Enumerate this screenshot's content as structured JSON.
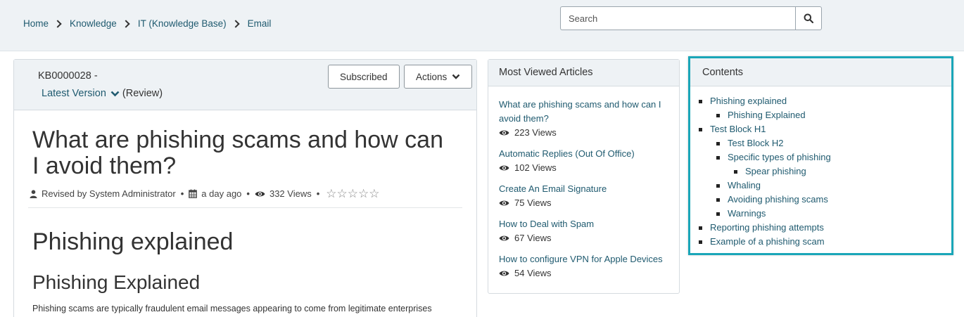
{
  "breadcrumb": [
    "Home",
    "Knowledge",
    "IT (Knowledge Base)",
    "Email"
  ],
  "search": {
    "placeholder": "Search"
  },
  "article": {
    "kb_number": "KB0000028 -",
    "version_label": "Latest Version",
    "version_status": "(Review)",
    "subscribed_label": "Subscribed",
    "actions_label": "Actions",
    "title": "What are phishing scams and how can I avoid them?",
    "meta": {
      "revised_by": "Revised by System Administrator",
      "time_ago": "a day ago",
      "views": "332 Views",
      "rating": 0,
      "max_rating": 5
    },
    "heading1": "Phishing explained",
    "heading2": "Phishing Explained",
    "paragraph": "Phishing scams are typically fraudulent email messages appearing to come from legitimate enterprises"
  },
  "most_viewed": {
    "title": "Most Viewed Articles",
    "items": [
      {
        "title": "What are phishing scams and how can I avoid them?",
        "views": "223 Views"
      },
      {
        "title": "Automatic Replies (Out Of Office)",
        "views": "102 Views"
      },
      {
        "title": "Create An Email Signature",
        "views": "75 Views"
      },
      {
        "title": "How to Deal with Spam",
        "views": "67 Views"
      },
      {
        "title": "How to configure VPN for Apple Devices",
        "views": "54 Views"
      }
    ]
  },
  "contents": {
    "title": "Contents",
    "items": [
      {
        "label": "Phishing explained",
        "level": 1
      },
      {
        "label": "Phishing Explained",
        "level": 2
      },
      {
        "label": "Test Block H1",
        "level": 1
      },
      {
        "label": "Test Block H2",
        "level": 2
      },
      {
        "label": "Specific types of phishing",
        "level": 2
      },
      {
        "label": "Spear phishing",
        "level": 3
      },
      {
        "label": "Whaling",
        "level": 2
      },
      {
        "label": "Avoiding phishing scams",
        "level": 2
      },
      {
        "label": "Warnings",
        "level": 2
      },
      {
        "label": "Reporting phishing attempts",
        "level": 1
      },
      {
        "label": "Example of a phishing scam",
        "level": 1
      }
    ]
  },
  "colors": {
    "link": "#1f5a6f",
    "highlight_border": "#1aa6b8",
    "header_bg": "#eef2f5"
  },
  "icons": {
    "search": "magnifier-icon",
    "user": "user-icon",
    "date": "calendar-icon",
    "views": "eye-icon",
    "rating": "star-outline-icon",
    "chevron": "chevron-down-icon",
    "breadcrumb_separator": "chevron-right-icon"
  }
}
